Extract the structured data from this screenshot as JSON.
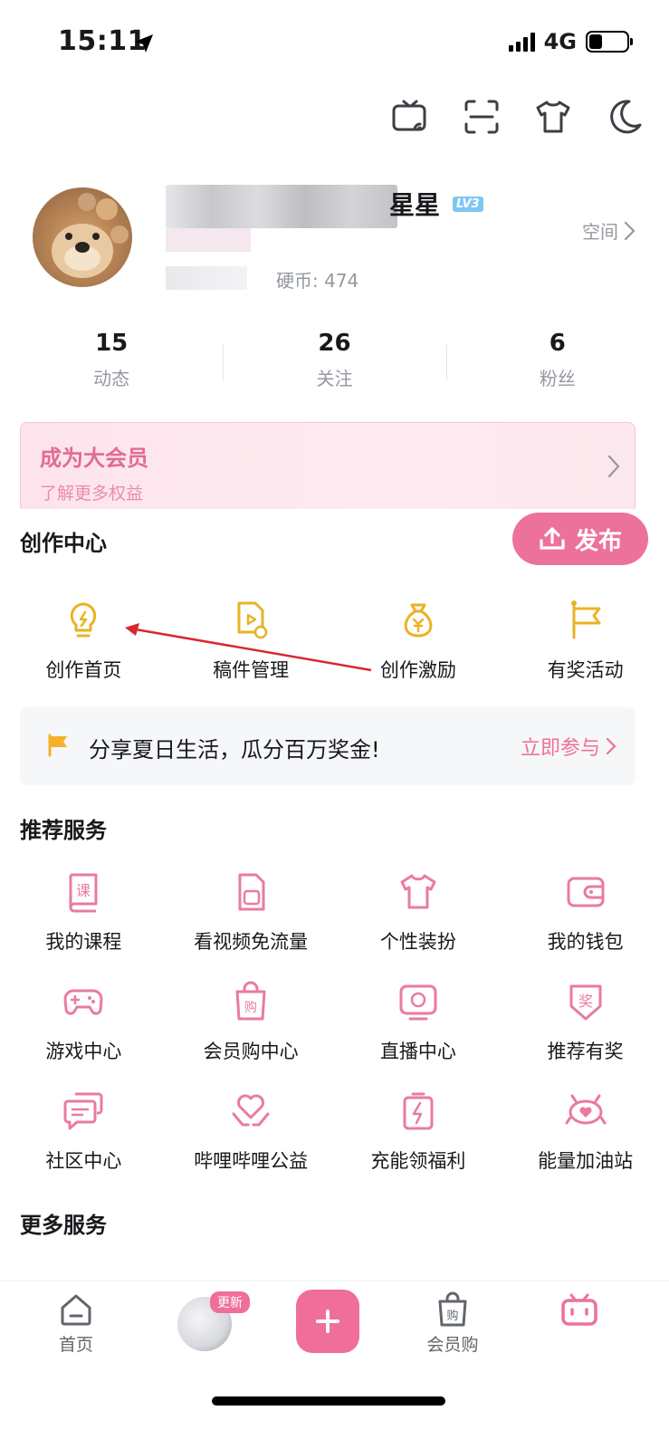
{
  "status_bar": {
    "time": "15:11",
    "network": "4G",
    "battery_level": 0.35
  },
  "top_actions": [
    {
      "name": "tv-cast-icon"
    },
    {
      "name": "scan-icon"
    },
    {
      "name": "theme-shirt-icon"
    },
    {
      "name": "night-mode-icon"
    }
  ],
  "profile": {
    "name_visible": "星星",
    "level": "LV3",
    "coins": "硬币: 474",
    "space_link": "空间"
  },
  "stats": [
    {
      "num": "15",
      "label": "动态"
    },
    {
      "num": "26",
      "label": "关注"
    },
    {
      "num": "6",
      "label": "粉丝"
    }
  ],
  "vip": {
    "title": "成为大会员",
    "subtitle": "了解更多权益"
  },
  "creation": {
    "title": "创作中心",
    "publish": "发布",
    "items": [
      {
        "label": "创作首页",
        "icon": "bulb-icon"
      },
      {
        "label": "稿件管理",
        "icon": "manuscript-icon"
      },
      {
        "label": "创作激励",
        "icon": "money-bag-icon"
      },
      {
        "label": "有奖活动",
        "icon": "flag-icon"
      }
    ]
  },
  "promo": {
    "text": "分享夏日生活，瓜分百万奖金!",
    "link": "立即参与"
  },
  "recommended": {
    "title": "推荐服务",
    "items": [
      {
        "label": "我的课程",
        "icon": "course-icon"
      },
      {
        "label": "看视频免流量",
        "icon": "sim-card-icon"
      },
      {
        "label": "个性装扮",
        "icon": "shirt-icon"
      },
      {
        "label": "我的钱包",
        "icon": "wallet-icon"
      },
      {
        "label": "游戏中心",
        "icon": "gamepad-icon"
      },
      {
        "label": "会员购中心",
        "icon": "shopping-bag-icon"
      },
      {
        "label": "直播中心",
        "icon": "live-tv-icon"
      },
      {
        "label": "推荐有奖",
        "icon": "reward-badge-icon"
      },
      {
        "label": "社区中心",
        "icon": "chat-icon"
      },
      {
        "label": "哔哩哔哩公益",
        "icon": "heart-hands-icon"
      },
      {
        "label": "充能领福利",
        "icon": "battery-charge-icon"
      },
      {
        "label": "能量加油站",
        "icon": "energy-station-icon"
      }
    ]
  },
  "more_services": {
    "title": "更多服务"
  },
  "bottom_nav": {
    "home": "首页",
    "update_badge": "更新",
    "shop": "会员购"
  }
}
